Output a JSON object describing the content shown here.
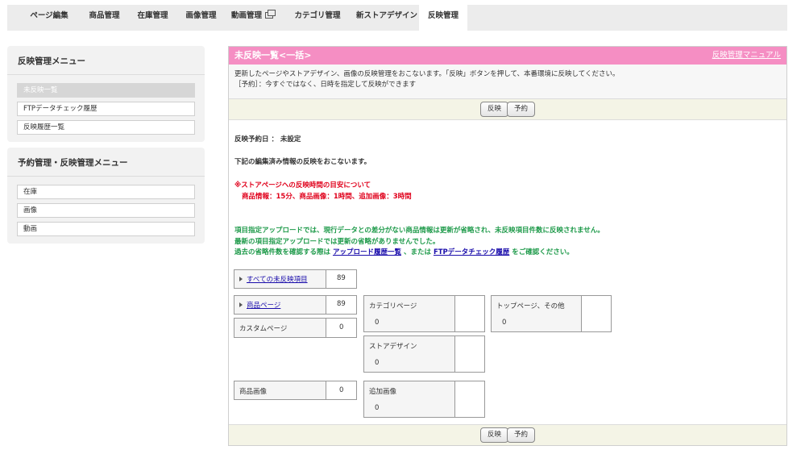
{
  "topnav": {
    "tabs": [
      {
        "label": "ページ編集"
      },
      {
        "label": "商品管理"
      },
      {
        "label": "在庫管理"
      },
      {
        "label": "画像管理"
      },
      {
        "label": "動画管理"
      },
      {
        "label": "カテゴリ管理"
      },
      {
        "label": "新ストアデザイン"
      },
      {
        "label": "反映管理"
      }
    ]
  },
  "sidebar": {
    "menu1": {
      "title": "反映管理メニュー",
      "items": [
        {
          "label": "未反映一覧"
        },
        {
          "label": "FTPデータチェック履歴"
        },
        {
          "label": "反映履歴一覧"
        }
      ]
    },
    "menu2": {
      "title": "予約管理・反映管理メニュー",
      "items": [
        {
          "label": "在庫"
        },
        {
          "label": "画像"
        },
        {
          "label": "動画"
        }
      ]
    }
  },
  "main": {
    "title": "未反映一覧<一括>",
    "manual_link": "反映管理マニュアル",
    "desc1": "更新したページやストアデザイン、画像の反映管理をおこないます。「反映」ボタンを押して、本番環境に反映してください。",
    "desc2": "［予約］：今すぐではなく、日時を指定して反映ができます",
    "btn_publish": "反映",
    "btn_reserve": "予約",
    "schedule": "反映予約日 ： 未設定",
    "note": "下記の編集済み情報の反映をおこないます。",
    "warn1": "※ストアページへの反映時間の目安について",
    "warn2": "商品情報：15分、商品画像：1時間、追加画像：3時間",
    "green1": "項目指定アップロードでは、現行データとの差分がない商品情報は更新が省略され、未反映項目件数に反映されません。",
    "green2": "最新の項目指定アップロードでは更新の省略がありませんでした。",
    "green3_pre": "過去の省略件数を確認する際は",
    "green3_link1": "アップロード履歴一覧",
    "green3_mid": "、または",
    "green3_link2": "FTPデータチェック履歴",
    "green3_post": "をご確認ください。"
  },
  "counts": {
    "all": {
      "label": "すべての未反映項目",
      "value": "89"
    },
    "item_page": {
      "label": "商品ページ",
      "value": "89"
    },
    "custom_page": {
      "label": "カスタムページ",
      "value": "0"
    },
    "category_page": {
      "label": "カテゴリページ",
      "value": "0"
    },
    "top_page": {
      "label": "トップページ、その他",
      "value": "0"
    },
    "store_design": {
      "label": "ストアデザイン",
      "value": "0"
    },
    "item_image": {
      "label": "商品画像",
      "value": "0"
    },
    "extra_image": {
      "label": "追加画像",
      "value": "0"
    }
  },
  "colors": {
    "header_pink": "#f58ec3",
    "warning_red": "#e0001b",
    "info_green": "#1e9a4a"
  }
}
